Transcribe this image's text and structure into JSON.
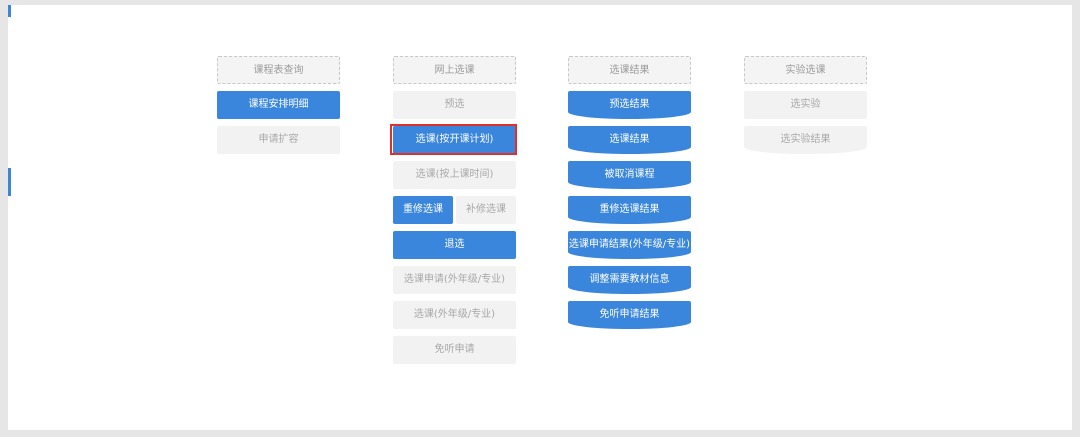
{
  "colors": {
    "primary": "#3a86dc",
    "disabled_bg": "#f2f2f2",
    "disabled_text": "#a8a8a8",
    "highlight": "#e0302c"
  },
  "columns": {
    "schedule": {
      "header": "课程表查询",
      "items": [
        "课程安排明细",
        "申请扩容"
      ]
    },
    "online": {
      "header": "网上选课",
      "items": [
        "预选",
        "选课(按开课计划)",
        "选课(按上课时间)",
        "重修选课",
        "补修选课",
        "退选",
        "选课申请(外年级/专业)",
        "选课(外年级/专业)",
        "免听申请"
      ]
    },
    "results": {
      "header": "选课结果",
      "items": [
        "预选结果",
        "选课结果",
        "被取消课程",
        "重修选课结果",
        "选课申请结果(外年级/专业)",
        "调整需要教材信息",
        "免听申请结果"
      ]
    },
    "lab": {
      "header": "实验选课",
      "items": [
        "选实验",
        "选实验结果"
      ]
    }
  }
}
